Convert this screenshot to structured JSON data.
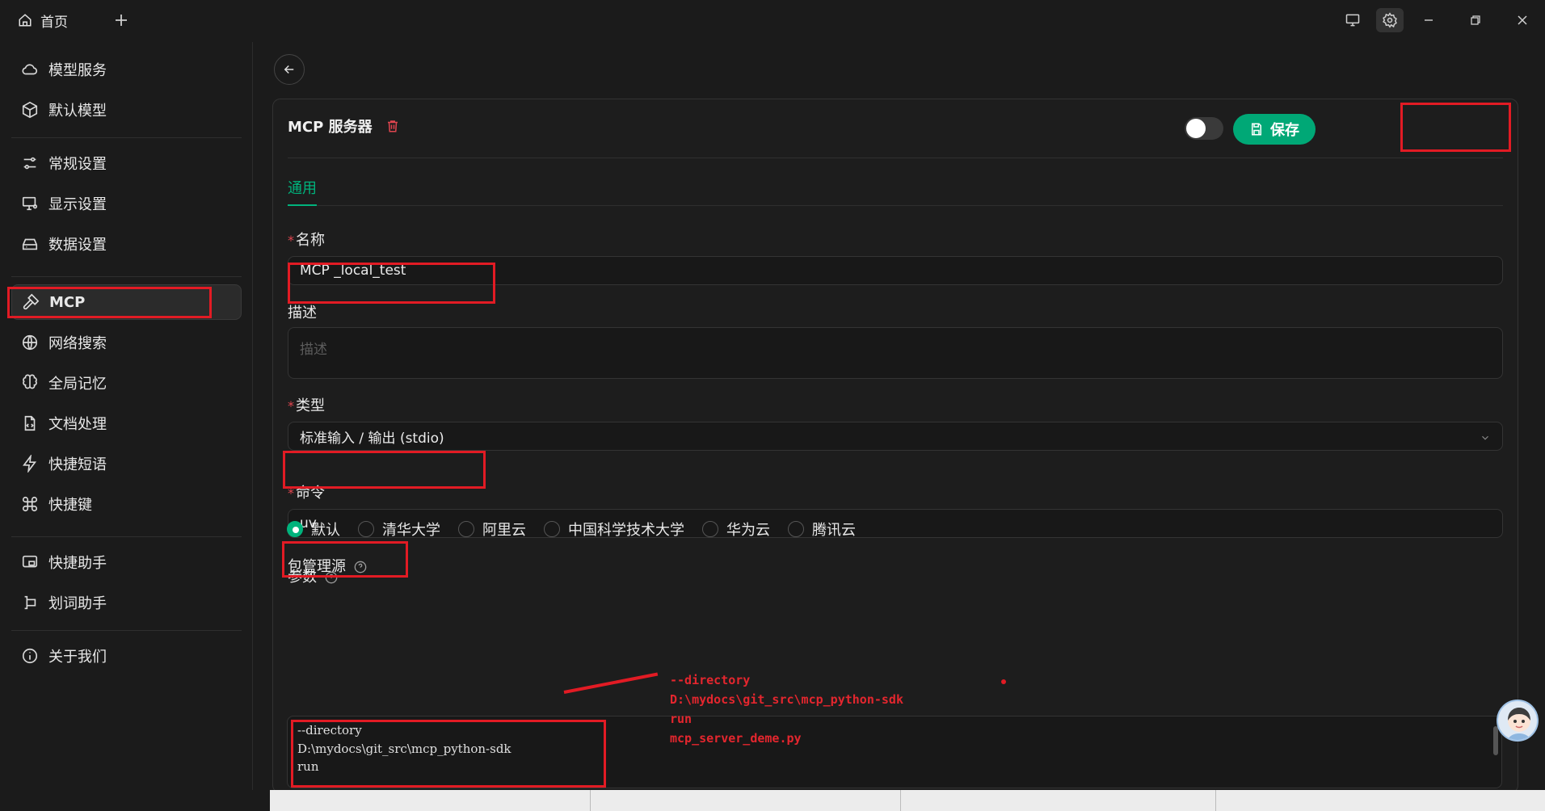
{
  "titlebar": {
    "home_tab": "首页",
    "add_tab_icon": "plus-icon",
    "buttons": [
      "monitor-icon",
      "gear-icon",
      "minimize-icon",
      "maximize-icon",
      "close-icon"
    ]
  },
  "sidebar": {
    "items": [
      {
        "label": "模型服务",
        "icon": "cloud-icon"
      },
      {
        "label": "默认模型",
        "icon": "cube-icon"
      },
      {
        "label": "常规设置",
        "icon": "sliders-icon"
      },
      {
        "label": "显示设置",
        "icon": "display-settings-icon"
      },
      {
        "label": "数据设置",
        "icon": "drive-icon"
      },
      {
        "label": "MCP",
        "icon": "hammer-icon"
      },
      {
        "label": "网络搜索",
        "icon": "globe-icon"
      },
      {
        "label": "全局记忆",
        "icon": "brain-icon"
      },
      {
        "label": "文档处理",
        "icon": "document-icon"
      },
      {
        "label": "快捷短语",
        "icon": "zap-icon"
      },
      {
        "label": "快捷键",
        "icon": "command-icon"
      },
      {
        "label": "快捷助手",
        "icon": "app-window-icon"
      },
      {
        "label": "划词助手",
        "icon": "text-select-icon"
      },
      {
        "label": "关于我们",
        "icon": "info-icon"
      }
    ]
  },
  "main": {
    "card_title": "MCP 服务器",
    "save_label": "保存",
    "enabled": false,
    "tab_general": "通用",
    "name": {
      "label": "名称",
      "value": "MCP _local_test"
    },
    "description": {
      "label": "描述",
      "placeholder": "描述"
    },
    "type": {
      "label": "类型",
      "value": "标准输入 / 输出 (stdio)"
    },
    "command": {
      "label": "命令",
      "value": "uv"
    },
    "registry": {
      "label": "包管理源",
      "selected": "默认",
      "options": [
        "默认",
        "清华大学",
        "阿里云",
        "中国科学技术大学",
        "华为云",
        "腾讯云"
      ]
    },
    "args": {
      "label": "参数",
      "lines": [
        "--directory",
        "D:\\mydocs\\git_src\\mcp_python-sdk",
        "run"
      ]
    }
  },
  "annotation": {
    "lines": [
      "--directory",
      "D:\\mydocs\\git_src\\mcp_python-sdk",
      "run",
      "mcp_server_deme.py"
    ],
    "color": "#e21b24"
  },
  "colors": {
    "accent": "#00b37c",
    "save": "#00a876",
    "required": "#e0454f"
  }
}
